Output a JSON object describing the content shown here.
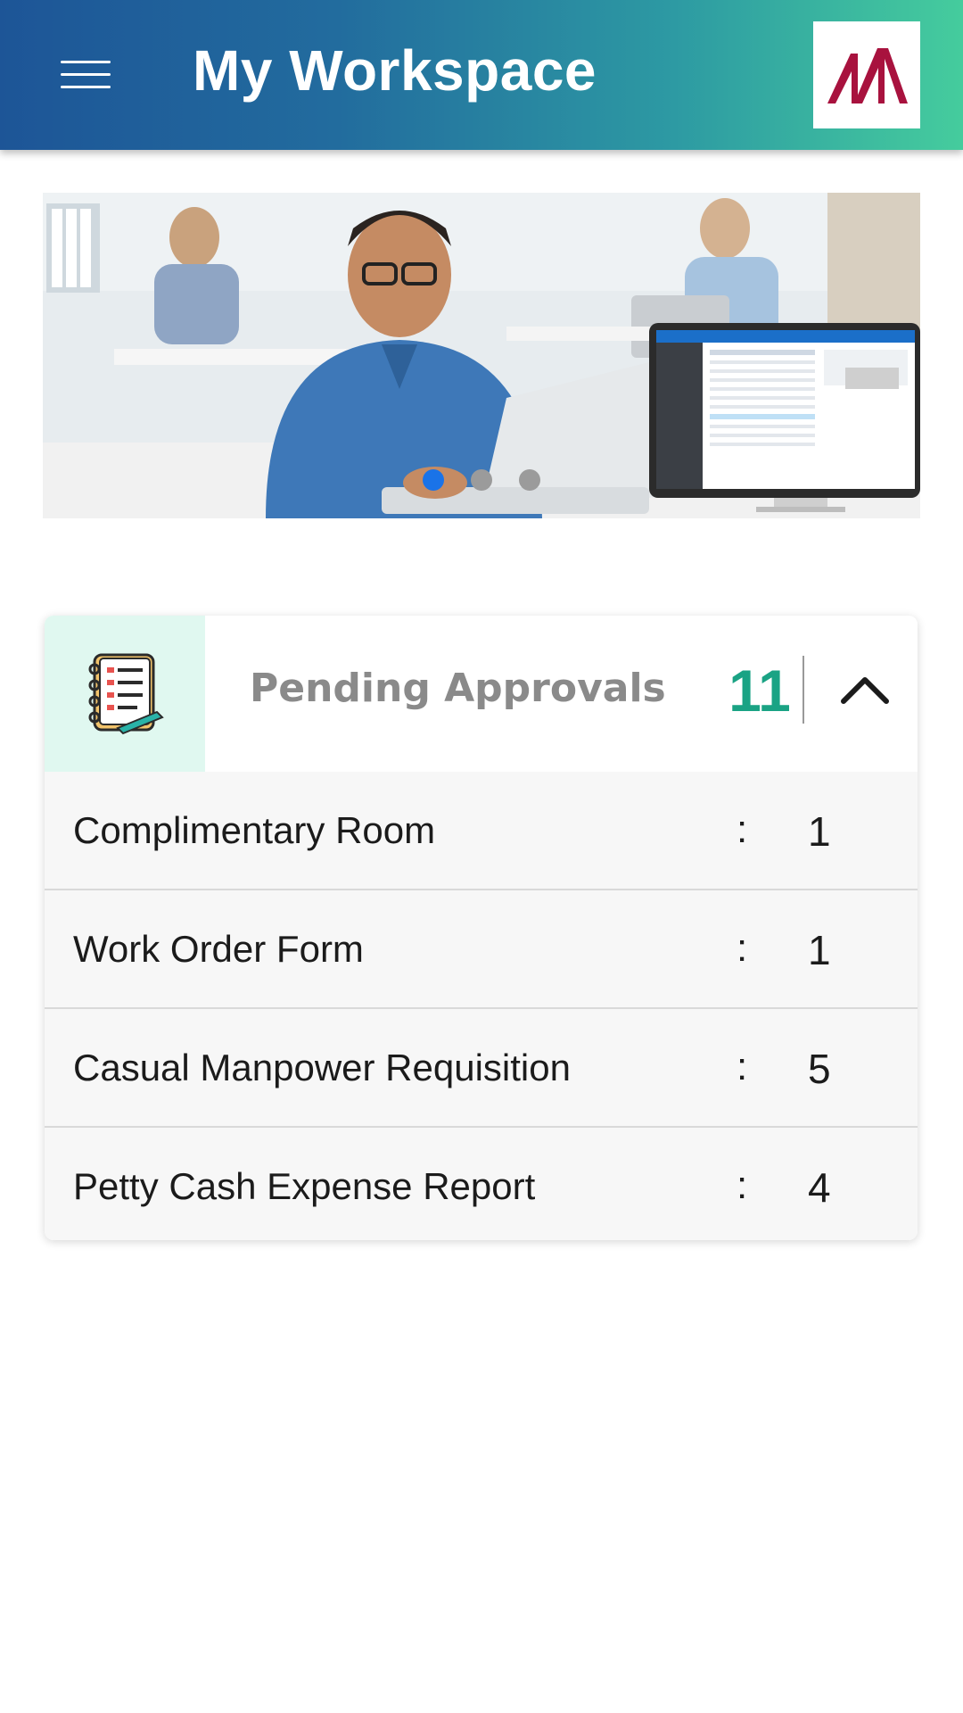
{
  "header": {
    "title": "My Workspace",
    "gradient": [
      "#1d5597",
      "#45cc9d"
    ],
    "logo_color": "#a8123e"
  },
  "carousel": {
    "slides": 3,
    "active_slide": 1,
    "active_dot_color": "#1a73e8"
  },
  "pending": {
    "title": "Pending Approvals",
    "count": "11",
    "accent": "#1aa384",
    "items": [
      {
        "label": "Complimentary Room",
        "sep": ":",
        "value": "1"
      },
      {
        "label": "Work Order Form",
        "sep": ":",
        "value": "1"
      },
      {
        "label": "Casual Manpower Requisition",
        "sep": ":",
        "value": "5"
      },
      {
        "label": "Petty Cash Expense Report",
        "sep": ":",
        "value": "4"
      }
    ]
  }
}
